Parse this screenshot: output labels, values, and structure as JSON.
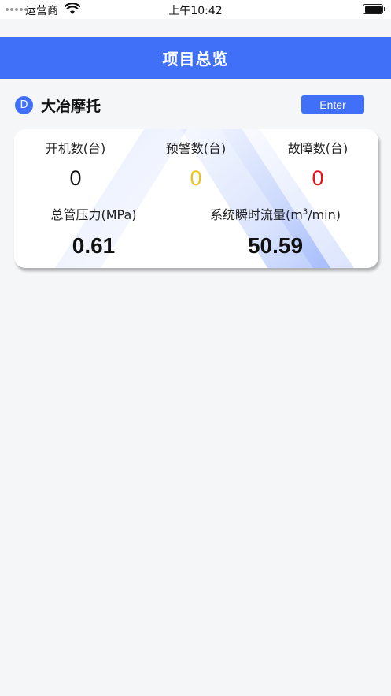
{
  "status_bar": {
    "carrier": "运营商",
    "time": "上午10:42"
  },
  "header": {
    "title": "项目总览"
  },
  "project": {
    "badge": "D",
    "name": "大冶摩托",
    "enter_label": "Enter"
  },
  "metrics": {
    "running": {
      "label": "开机数(台)",
      "value": "0",
      "color": "#111111"
    },
    "warning": {
      "label": "预警数(台)",
      "value": "0",
      "color": "#f2c21b"
    },
    "fault": {
      "label": "故障数(台)",
      "value": "0",
      "color": "#e8101a"
    },
    "pressure": {
      "label": "总管压力(MPa)",
      "value": "0.61"
    },
    "flow": {
      "label_prefix": "系统瞬时流量(m",
      "label_sup": "3",
      "label_suffix": "/min)",
      "value": "50.59"
    }
  },
  "colors": {
    "brand": "#3f70f7",
    "background": "#f5f6f8"
  }
}
